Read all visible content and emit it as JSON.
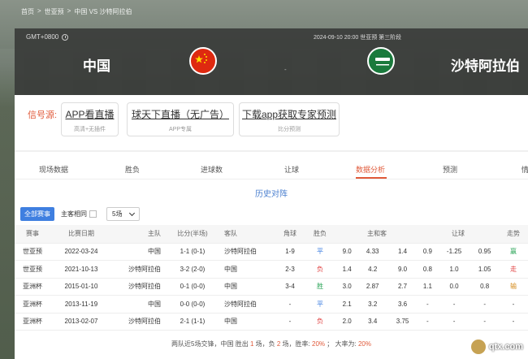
{
  "breadcrumb": [
    "首页",
    ">",
    "世亚预",
    ">",
    "中国 VS 沙特阿拉伯"
  ],
  "header": {
    "timezone": "GMT+0800",
    "match_info": "2024-09-10 20:00  世亚预 第三阶段",
    "home_team": "中国",
    "away_team": "沙特阿拉伯",
    "vs": "-"
  },
  "signal_label": "信号源:",
  "sources": [
    {
      "title": "APP看直播",
      "sub": "高清+无插件"
    },
    {
      "title": "球天下直播（无广告）",
      "sub": "APP专属"
    },
    {
      "title": "下载app获取专家预测",
      "sub": "比分预测"
    }
  ],
  "tabs": [
    "现场数据",
    "胜负",
    "进球数",
    "让球",
    "数据分析",
    "预测",
    "情"
  ],
  "active_tab": 4,
  "section_title": "历史对阵",
  "filters": {
    "all": "全部赛事",
    "home_same": "主客相同",
    "count": "5场"
  },
  "table": {
    "headers": [
      "赛事",
      "比赛日期",
      "主队",
      "比分(半场)",
      "客队",
      "角球",
      "胜负",
      "主和客",
      "让球",
      "走势"
    ],
    "rows": [
      {
        "league": "世亚预",
        "date": "2022-03-24",
        "home": "中国",
        "score": "1-1 (0-1)",
        "away": "沙特阿拉伯",
        "corner": "1-9",
        "result": "平",
        "rclass": "res-ping",
        "o1": "9.0",
        "o2": "4.33",
        "o3": "1.4",
        "h1": "0.9",
        "h2": "-1.25",
        "h3": "0.95",
        "trend": "赢",
        "tclass": "trend-g"
      },
      {
        "league": "世亚预",
        "date": "2021-10-13",
        "home": "沙特阿拉伯",
        "score": "3-2 (2-0)",
        "away": "中国",
        "corner": "2-3",
        "result": "负",
        "rclass": "res-fu",
        "o1": "1.4",
        "o2": "4.2",
        "o3": "9.0",
        "h1": "0.8",
        "h2": "1.0",
        "h3": "1.05",
        "trend": "走",
        "tclass": "trend-r"
      },
      {
        "league": "亚洲杯",
        "date": "2015-01-10",
        "home": "沙特阿拉伯",
        "score": "0-1 (0-0)",
        "away": "中国",
        "corner": "3-4",
        "result": "胜",
        "rclass": "res-sheng",
        "o1": "3.0",
        "o2": "2.87",
        "o3": "2.7",
        "h1": "1.1",
        "h2": "0.0",
        "h3": "0.8",
        "trend": "输",
        "tclass": "trend-b"
      },
      {
        "league": "亚洲杯",
        "date": "2013-11-19",
        "home": "中国",
        "score": "0-0 (0-0)",
        "away": "沙特阿拉伯",
        "corner": "-",
        "result": "平",
        "rclass": "res-ping",
        "o1": "2.1",
        "o2": "3.2",
        "o3": "3.6",
        "h1": "-",
        "h2": "-",
        "h3": "-",
        "trend": "-",
        "tclass": ""
      },
      {
        "league": "亚洲杯",
        "date": "2013-02-07",
        "home": "沙特阿拉伯",
        "score": "2-1 (1-1)",
        "away": "中国",
        "corner": "-",
        "result": "负",
        "rclass": "res-fu",
        "o1": "2.0",
        "o2": "3.4",
        "o3": "3.75",
        "h1": "-",
        "h2": "-",
        "h3": "-",
        "trend": "-",
        "tclass": ""
      }
    ]
  },
  "summary": {
    "p1": "两队近5场交锋，中国 胜出",
    "wins": "1",
    "p2": "场，负",
    "losses": "2",
    "p3": "场，胜率:",
    "win_rate": "20%",
    "p4": "；  大率为:",
    "over_rate": "20%"
  },
  "watermark": "qtx.com",
  "colors": {
    "accent": "#e05a3a",
    "blue": "#3f7fe0",
    "header_bg": "#3a3c3a"
  }
}
